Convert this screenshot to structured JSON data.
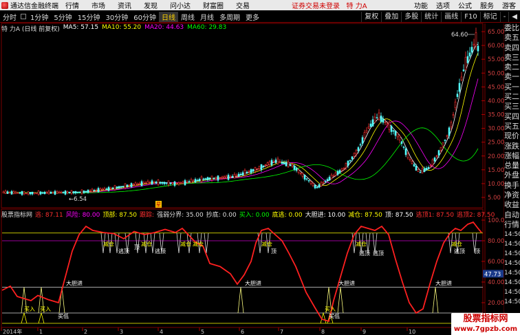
{
  "menubar": {
    "app_title": "通达信金融终端",
    "items": [
      "行情",
      "市场",
      "资讯",
      "发现",
      "问小达",
      "财富圈",
      "交易"
    ],
    "warning": "证券交易未登录",
    "stock_title": "特 力A",
    "right_items": [
      "功能",
      "选项",
      "公式",
      "服务",
      "游客"
    ]
  },
  "toolbar": {
    "periods": [
      "分时",
      "1分钟",
      "5分钟",
      "15分钟",
      "30分钟",
      "60分钟",
      "日线",
      "周线",
      "月线",
      "多周期",
      "更多"
    ],
    "selected": "日线",
    "right_buttons": [
      "复权",
      "叠加",
      "多股",
      "统计",
      "画线",
      "F10",
      "标记",
      "-",
      "◀"
    ]
  },
  "price_info": {
    "name": "特 力A (日线 前复权)",
    "ma5": "MA5: 57.15",
    "ma10": "MA10: 55.20",
    "ma20": "MA20: 44.63",
    "ma60": "MA60: 29.83",
    "high_label": "64.60",
    "low_label": "6.54",
    "colors": {
      "ma5": "#ffffff",
      "ma10": "#ffff00",
      "ma20": "#ff00ff",
      "ma60": "#00ff00"
    }
  },
  "price_axis": [
    "65.00",
    "60.00",
    "55.00",
    "50.00",
    "45.00",
    "40.00",
    "35.00",
    "30.00",
    "25.00",
    "20.00",
    "15.00",
    "10.00",
    "5.00"
  ],
  "indicator": {
    "title": "股票指标网",
    "items": [
      {
        "label": "逃:",
        "value": "87.11",
        "color": "#ff3030"
      },
      {
        "label": "风险:",
        "value": "80.00",
        "color": "#ff00ff"
      },
      {
        "label": "顶部:",
        "value": "87.50",
        "color": "#ffff00"
      },
      {
        "label": "跟踪:",
        "value": "",
        "color": "#ff3030"
      },
      {
        "label": "强弱分界:",
        "value": "35.00",
        "color": "#dddddd"
      },
      {
        "label": "抄底:",
        "value": "0.00",
        "color": "#dddddd"
      },
      {
        "label": "买入:",
        "value": "0.00",
        "color": "#00ff00"
      },
      {
        "label": "底逃:",
        "value": "0.00",
        "color": "#ffff00"
      },
      {
        "label": "大胆进:",
        "value": "10.00",
        "color": "#ffffff"
      },
      {
        "label": "减仓:",
        "value": "87.50",
        "color": "#ffff00"
      },
      {
        "label": "顶:",
        "value": "87.50",
        "color": "#ffffff"
      },
      {
        "label": "逃顶1:",
        "value": "87.50",
        "color": "#ff3030"
      },
      {
        "label": "逃顶2:",
        "value": "87.50",
        "color": "#ff3030"
      }
    ],
    "axis": [
      "100.0",
      "80.00",
      "60.00",
      "40.00",
      "20.00"
    ],
    "cursor_value": "47.73",
    "signal_labels": {
      "reduce": "减仓",
      "top": "顶",
      "escape_top": "逃顶",
      "bold_in": "大胆进",
      "buy": "买入",
      "buy_low": "买低"
    }
  },
  "side_panel": {
    "items": [
      "委比",
      "卖五",
      "卖四",
      "卖三",
      "卖二",
      "卖一",
      "买一",
      "买二",
      "买三",
      "买四",
      "买五",
      "现价",
      "涨跌",
      "涨幅",
      "总量",
      "外盘",
      "换手",
      "净资",
      "收益",
      "自动",
      "行情",
      "14:50",
      "14:50",
      "14:50",
      "14:50",
      "14:50",
      "14:50",
      "14:50",
      "14:50"
    ]
  },
  "time_axis": [
    "2014年",
    "1",
    "2",
    "3",
    "4",
    "5",
    "6",
    "7",
    "8",
    "9",
    "10"
  ],
  "red_marker": "星",
  "watermark": {
    "line1": "股票指标网",
    "line2": "www.7gpzb.com"
  }
}
